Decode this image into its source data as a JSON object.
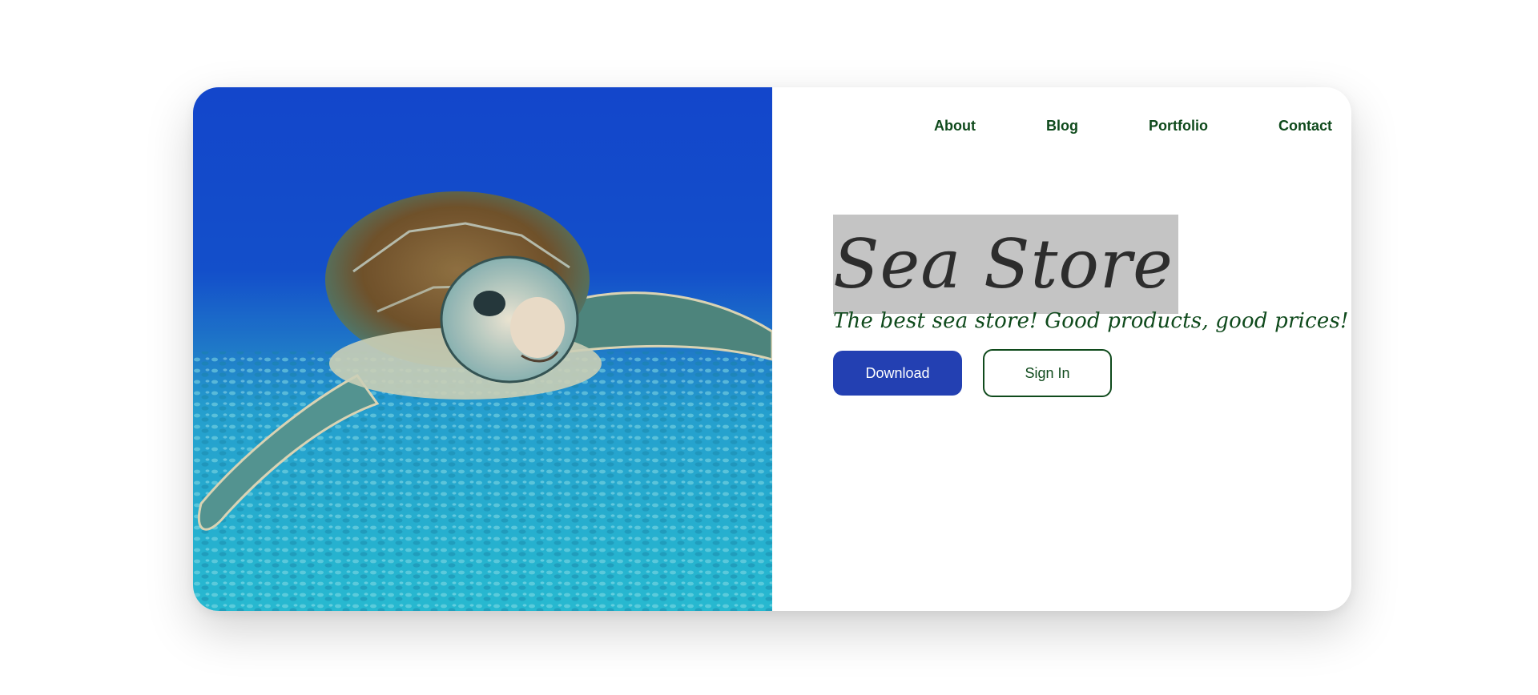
{
  "nav": {
    "items": [
      {
        "label": "About"
      },
      {
        "label": "Blog"
      },
      {
        "label": "Portfolio"
      },
      {
        "label": "Contact"
      }
    ]
  },
  "hero": {
    "title": "Sea Store",
    "subtitle": "The best sea store! Good products, good prices!"
  },
  "actions": {
    "primary_label": "Download",
    "secondary_label": "Sign In"
  },
  "colors": {
    "nav_text": "#0f4a1c",
    "primary_button": "#2340b2",
    "title_highlight": "#c4c4c4"
  }
}
